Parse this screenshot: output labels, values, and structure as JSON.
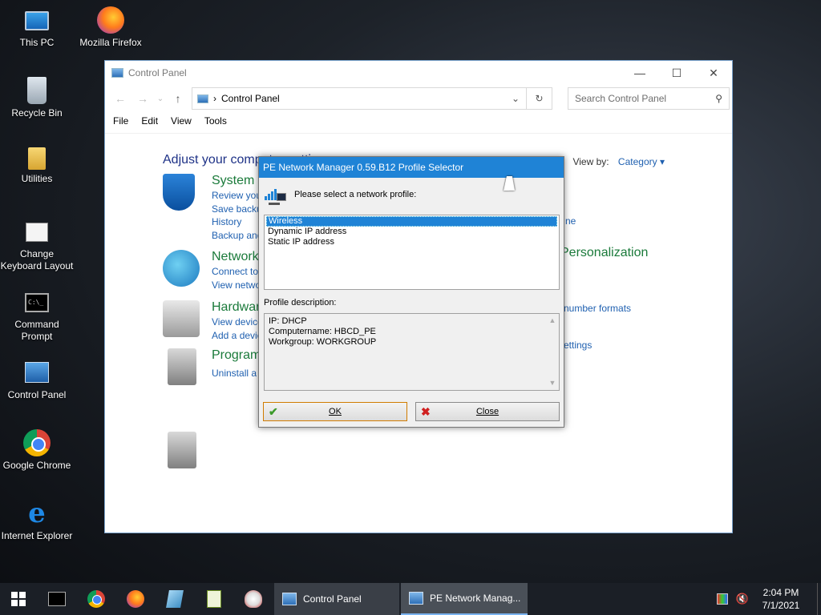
{
  "desktop": {
    "icons": [
      {
        "label": "This PC"
      },
      {
        "label": "Mozilla Firefox"
      },
      {
        "label": "Recycle Bin"
      },
      {
        "label": "Utilities"
      },
      {
        "label": "Change Keyboard Layout"
      },
      {
        "label": "Command Prompt"
      },
      {
        "label": "Control Panel"
      },
      {
        "label": "Google Chrome"
      },
      {
        "label": "Internet Explorer"
      }
    ],
    "cmd_glyph": "C:\\_"
  },
  "control_panel": {
    "title": "Control Panel",
    "window_controls": {
      "minimize": "—",
      "maximize": "☐",
      "close": "✕"
    },
    "nav": {
      "back": "←",
      "forward": "→",
      "recent": "⌄",
      "up": "↑"
    },
    "address": {
      "separator": "›",
      "path": "Control Panel",
      "dropdown": "⌄",
      "refresh": "↻"
    },
    "search_placeholder": "Search Control Panel",
    "search_icon_glyph": "⚲",
    "menu": [
      "File",
      "Edit",
      "View",
      "Tools"
    ],
    "heading": "Adjust your comp",
    "heading_tail": "uter settings",
    "view_by_label": "View by:",
    "view_by_value": "Category",
    "view_by_arrow": "▾",
    "categories": [
      {
        "title": "System a",
        "links": [
          "Review you",
          "Save backu",
          "History",
          "Backup and"
        ]
      },
      {
        "title": "Network",
        "links": [
          "Connect to",
          "View netwo"
        ]
      },
      {
        "title": "Hardwar",
        "links": [
          "View device",
          "Add a devic"
        ]
      },
      {
        "title": "Program",
        "links": [
          "Uninstall a"
        ]
      }
    ],
    "right_fragments": {
      "r1": "ne",
      "personalization": "Personalization",
      "number_formats": "number formats",
      "settings": "ettings"
    }
  },
  "dialog": {
    "title": "PE Network Manager 0.59.B12 Profile Selector",
    "prompt": "Please select a network profile:",
    "profiles": [
      "Wireless",
      "Dynamic IP address",
      "Static IP address"
    ],
    "selected_index": 0,
    "description_label": "Profile description:",
    "description_lines": [
      "IP: DHCP",
      "Computername: HBCD_PE",
      "Workgroup: WORKGROUP"
    ],
    "scroll_up": "▲",
    "scroll_down": "▼",
    "ok_label": "OK",
    "ok_icon": "✔",
    "close_label": "Close",
    "close_icon": "✖"
  },
  "taskbar": {
    "tasks": [
      {
        "label": "Control Panel",
        "active": false
      },
      {
        "label": "PE Network Manag...",
        "active": true
      }
    ],
    "volume_glyph": "🔇",
    "time": "2:04 PM",
    "date": "7/1/2021"
  }
}
